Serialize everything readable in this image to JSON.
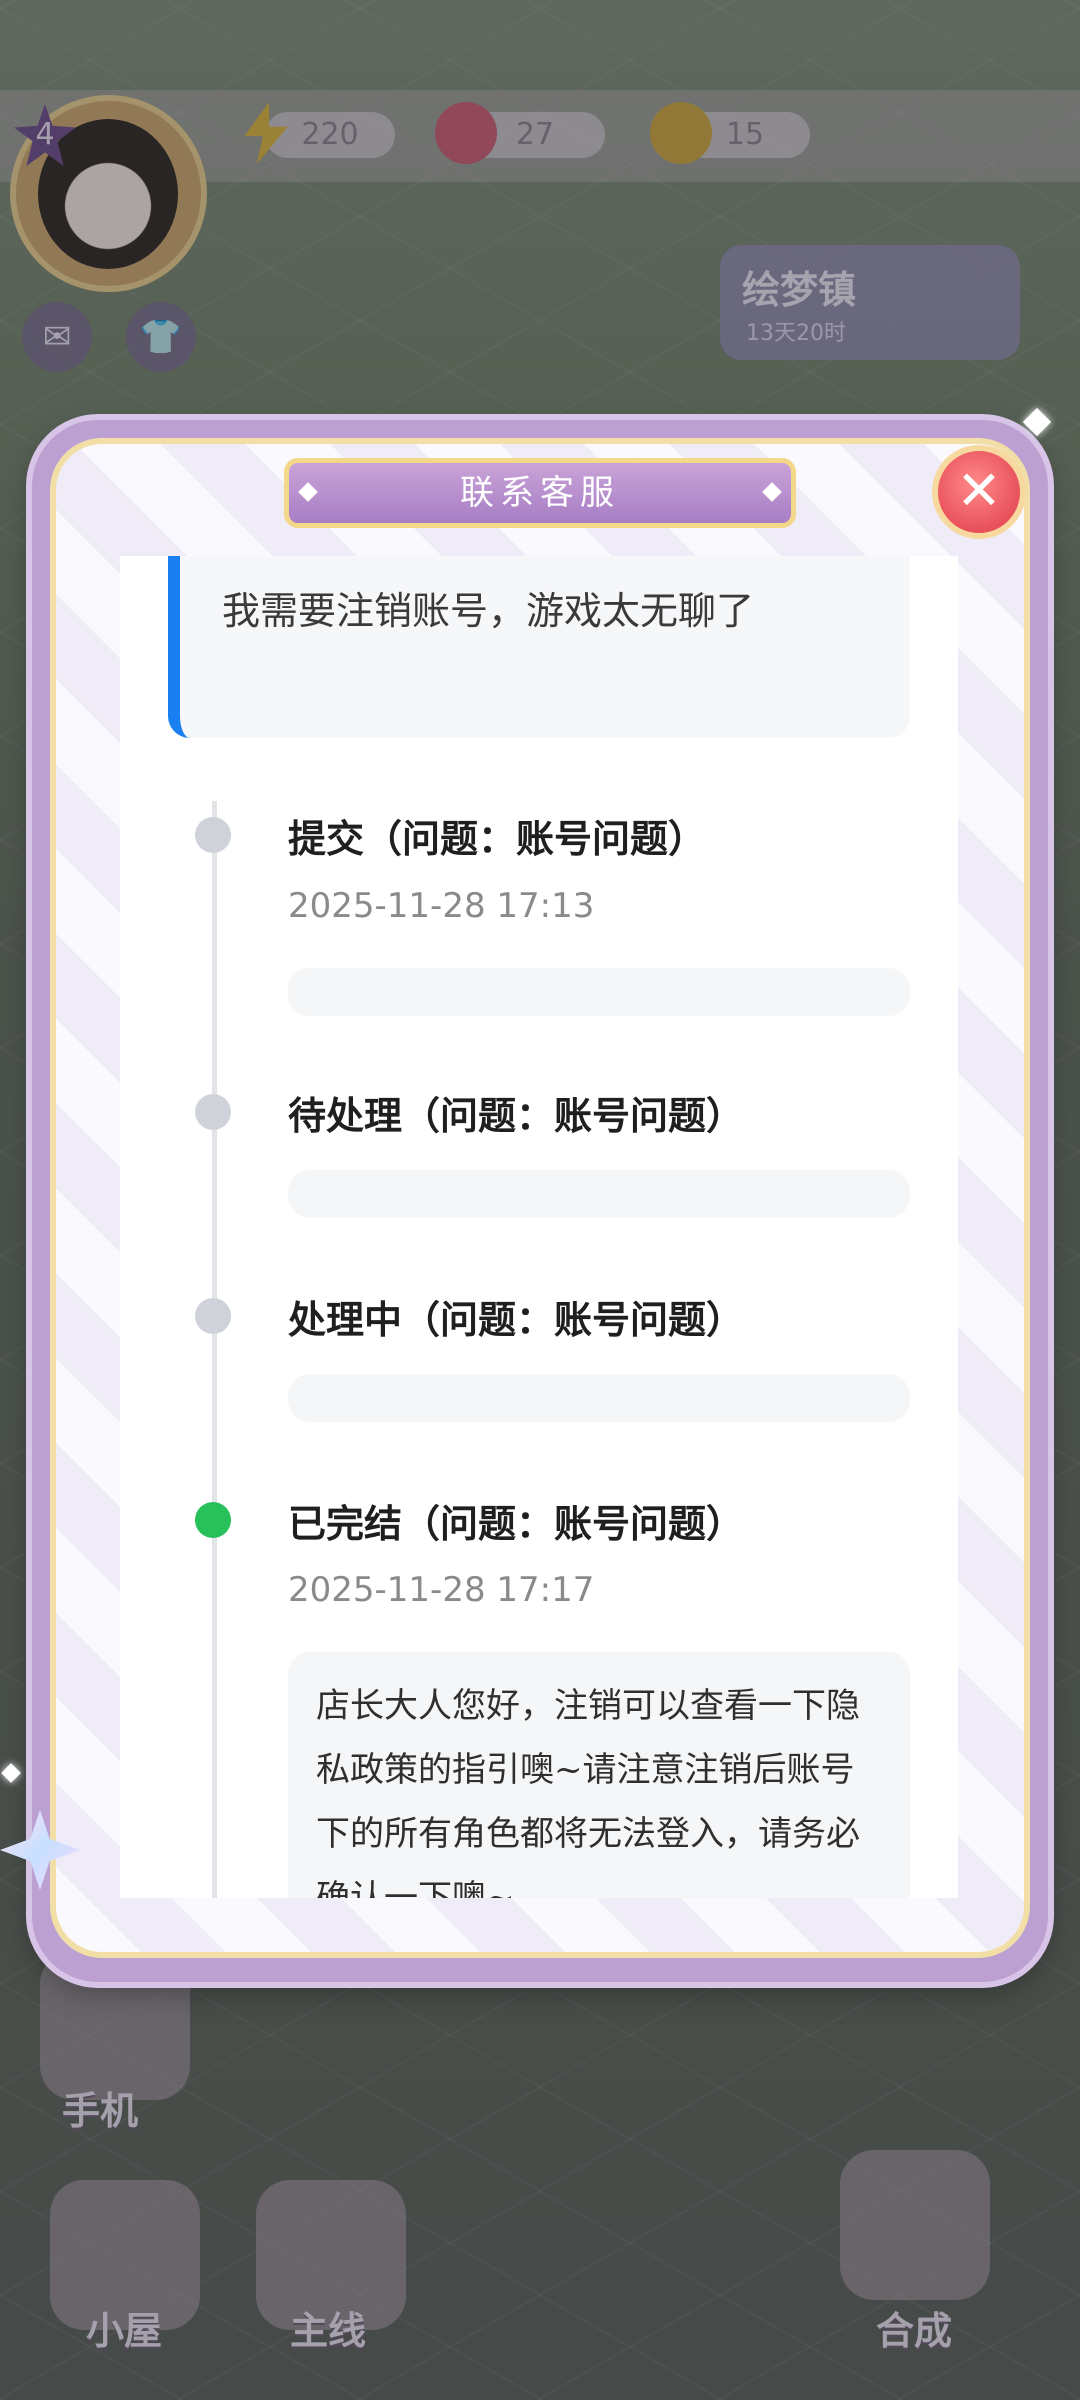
{
  "hud": {
    "level": "4",
    "energy": "220",
    "gems": "27",
    "coins": "15",
    "town_name": "绘梦镇",
    "town_timer": "13天20时"
  },
  "bottom_nav": {
    "phone": "手机",
    "house": "小屋",
    "mainline": "主线",
    "merge": "合成"
  },
  "dialog": {
    "title": "联系客服",
    "message": "我需要注销账号，游戏太无聊了",
    "events": [
      {
        "title": "提交（问题：账号问题）",
        "time": "2025-11-28 17:13",
        "done": false
      },
      {
        "title": "待处理（问题：账号问题）",
        "time": "",
        "done": false
      },
      {
        "title": "处理中（问题：账号问题）",
        "time": "",
        "done": false
      },
      {
        "title": "已完结（问题：账号问题）",
        "time": "2025-11-28 17:17",
        "done": true
      }
    ],
    "reply": "店长大人您好，注销可以查看一下隐私政策的指引噢~请注意注销后账号下的所有角色都将无法登入，请务必确认一下噢~"
  },
  "colors": {
    "accent_blue": "#1a7ff0",
    "status_done": "#27c05a",
    "status_pending": "#cfd2d8",
    "close_red": "#e8505a",
    "title_purple": "#a77ec4"
  }
}
